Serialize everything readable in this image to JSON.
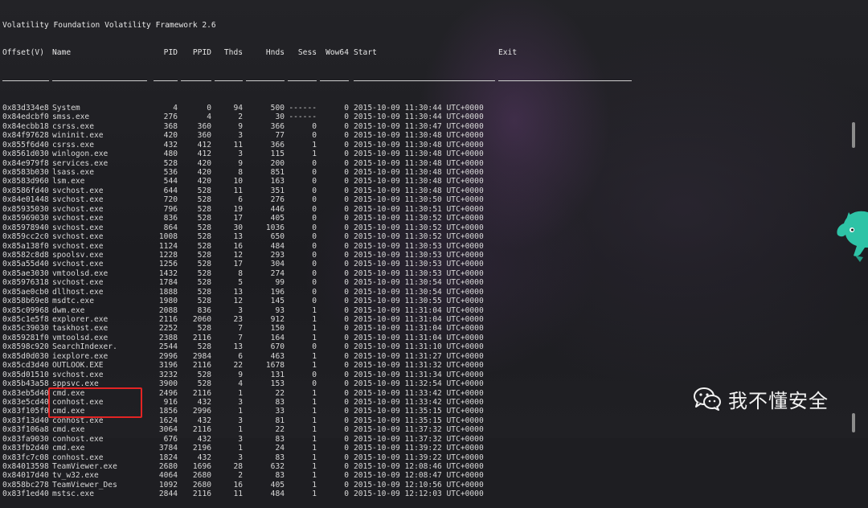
{
  "terminal": {
    "banner": "Volatility Foundation Volatility Framework 2.6",
    "columns": {
      "offset": "Offset(V)",
      "name": "Name",
      "pid": "PID",
      "ppid": "PPID",
      "thds": "Thds",
      "hnds": "Hnds",
      "sess": "Sess",
      "wow64": "Wow64",
      "start": "Start",
      "exit": "Exit"
    },
    "rows": [
      {
        "offset": "0x83d334e8",
        "name": "System",
        "pid": "4",
        "ppid": "0",
        "thds": "94",
        "hnds": "500",
        "sess": "------",
        "wow64": "0",
        "start": "2015-10-09 11:30:44 UTC+0000"
      },
      {
        "offset": "0x84edcbf0",
        "name": "smss.exe",
        "pid": "276",
        "ppid": "4",
        "thds": "2",
        "hnds": "30",
        "sess": "------",
        "wow64": "0",
        "start": "2015-10-09 11:30:44 UTC+0000"
      },
      {
        "offset": "0x84ecbb18",
        "name": "csrss.exe",
        "pid": "368",
        "ppid": "360",
        "thds": "9",
        "hnds": "366",
        "sess": "0",
        "wow64": "0",
        "start": "2015-10-09 11:30:47 UTC+0000"
      },
      {
        "offset": "0x84f97628",
        "name": "wininit.exe",
        "pid": "420",
        "ppid": "360",
        "thds": "3",
        "hnds": "77",
        "sess": "0",
        "wow64": "0",
        "start": "2015-10-09 11:30:48 UTC+0000"
      },
      {
        "offset": "0x855f6d40",
        "name": "csrss.exe",
        "pid": "432",
        "ppid": "412",
        "thds": "11",
        "hnds": "366",
        "sess": "1",
        "wow64": "0",
        "start": "2015-10-09 11:30:48 UTC+0000"
      },
      {
        "offset": "0x8561d030",
        "name": "winlogon.exe",
        "pid": "480",
        "ppid": "412",
        "thds": "3",
        "hnds": "115",
        "sess": "1",
        "wow64": "0",
        "start": "2015-10-09 11:30:48 UTC+0000"
      },
      {
        "offset": "0x84e979f8",
        "name": "services.exe",
        "pid": "528",
        "ppid": "420",
        "thds": "9",
        "hnds": "200",
        "sess": "0",
        "wow64": "0",
        "start": "2015-10-09 11:30:48 UTC+0000"
      },
      {
        "offset": "0x8583b030",
        "name": "lsass.exe",
        "pid": "536",
        "ppid": "420",
        "thds": "8",
        "hnds": "851",
        "sess": "0",
        "wow64": "0",
        "start": "2015-10-09 11:30:48 UTC+0000"
      },
      {
        "offset": "0x8583d960",
        "name": "lsm.exe",
        "pid": "544",
        "ppid": "420",
        "thds": "10",
        "hnds": "163",
        "sess": "0",
        "wow64": "0",
        "start": "2015-10-09 11:30:48 UTC+0000"
      },
      {
        "offset": "0x8586fd40",
        "name": "svchost.exe",
        "pid": "644",
        "ppid": "528",
        "thds": "11",
        "hnds": "351",
        "sess": "0",
        "wow64": "0",
        "start": "2015-10-09 11:30:48 UTC+0000"
      },
      {
        "offset": "0x84e01448",
        "name": "svchost.exe",
        "pid": "720",
        "ppid": "528",
        "thds": "6",
        "hnds": "276",
        "sess": "0",
        "wow64": "0",
        "start": "2015-10-09 11:30:50 UTC+0000"
      },
      {
        "offset": "0x85935030",
        "name": "svchost.exe",
        "pid": "796",
        "ppid": "528",
        "thds": "19",
        "hnds": "446",
        "sess": "0",
        "wow64": "0",
        "start": "2015-10-09 11:30:51 UTC+0000"
      },
      {
        "offset": "0x85969030",
        "name": "svchost.exe",
        "pid": "836",
        "ppid": "528",
        "thds": "17",
        "hnds": "405",
        "sess": "0",
        "wow64": "0",
        "start": "2015-10-09 11:30:52 UTC+0000"
      },
      {
        "offset": "0x85978940",
        "name": "svchost.exe",
        "pid": "864",
        "ppid": "528",
        "thds": "30",
        "hnds": "1036",
        "sess": "0",
        "wow64": "0",
        "start": "2015-10-09 11:30:52 UTC+0000"
      },
      {
        "offset": "0x859cc2c0",
        "name": "svchost.exe",
        "pid": "1008",
        "ppid": "528",
        "thds": "13",
        "hnds": "650",
        "sess": "0",
        "wow64": "0",
        "start": "2015-10-09 11:30:52 UTC+0000"
      },
      {
        "offset": "0x85a138f0",
        "name": "svchost.exe",
        "pid": "1124",
        "ppid": "528",
        "thds": "16",
        "hnds": "484",
        "sess": "0",
        "wow64": "0",
        "start": "2015-10-09 11:30:53 UTC+0000"
      },
      {
        "offset": "0x8582c8d8",
        "name": "spoolsv.exe",
        "pid": "1228",
        "ppid": "528",
        "thds": "12",
        "hnds": "293",
        "sess": "0",
        "wow64": "0",
        "start": "2015-10-09 11:30:53 UTC+0000"
      },
      {
        "offset": "0x85a55d40",
        "name": "svchost.exe",
        "pid": "1256",
        "ppid": "528",
        "thds": "17",
        "hnds": "304",
        "sess": "0",
        "wow64": "0",
        "start": "2015-10-09 11:30:53 UTC+0000"
      },
      {
        "offset": "0x85ae3030",
        "name": "vmtoolsd.exe",
        "pid": "1432",
        "ppid": "528",
        "thds": "8",
        "hnds": "274",
        "sess": "0",
        "wow64": "0",
        "start": "2015-10-09 11:30:53 UTC+0000"
      },
      {
        "offset": "0x85976318",
        "name": "svchost.exe",
        "pid": "1784",
        "ppid": "528",
        "thds": "5",
        "hnds": "99",
        "sess": "0",
        "wow64": "0",
        "start": "2015-10-09 11:30:54 UTC+0000"
      },
      {
        "offset": "0x85ae0cb0",
        "name": "dllhost.exe",
        "pid": "1888",
        "ppid": "528",
        "thds": "13",
        "hnds": "196",
        "sess": "0",
        "wow64": "0",
        "start": "2015-10-09 11:30:54 UTC+0000"
      },
      {
        "offset": "0x858b69e8",
        "name": "msdtc.exe",
        "pid": "1980",
        "ppid": "528",
        "thds": "12",
        "hnds": "145",
        "sess": "0",
        "wow64": "0",
        "start": "2015-10-09 11:30:55 UTC+0000"
      },
      {
        "offset": "0x85c09968",
        "name": "dwm.exe",
        "pid": "2088",
        "ppid": "836",
        "thds": "3",
        "hnds": "93",
        "sess": "1",
        "wow64": "0",
        "start": "2015-10-09 11:31:04 UTC+0000"
      },
      {
        "offset": "0x85c1e5f8",
        "name": "explorer.exe",
        "pid": "2116",
        "ppid": "2060",
        "thds": "23",
        "hnds": "912",
        "sess": "1",
        "wow64": "0",
        "start": "2015-10-09 11:31:04 UTC+0000"
      },
      {
        "offset": "0x85c39030",
        "name": "taskhost.exe",
        "pid": "2252",
        "ppid": "528",
        "thds": "7",
        "hnds": "150",
        "sess": "1",
        "wow64": "0",
        "start": "2015-10-09 11:31:04 UTC+0000"
      },
      {
        "offset": "0x859281f0",
        "name": "vmtoolsd.exe",
        "pid": "2388",
        "ppid": "2116",
        "thds": "7",
        "hnds": "164",
        "sess": "1",
        "wow64": "0",
        "start": "2015-10-09 11:31:04 UTC+0000"
      },
      {
        "offset": "0x8598c920",
        "name": "SearchIndexer.",
        "pid": "2544",
        "ppid": "528",
        "thds": "13",
        "hnds": "670",
        "sess": "0",
        "wow64": "0",
        "start": "2015-10-09 11:31:10 UTC+0000"
      },
      {
        "offset": "0x85d0d030",
        "name": "iexplore.exe",
        "pid": "2996",
        "ppid": "2984",
        "thds": "6",
        "hnds": "463",
        "sess": "1",
        "wow64": "0",
        "start": "2015-10-09 11:31:27 UTC+0000"
      },
      {
        "offset": "0x85cd3d40",
        "name": "OUTLOOK.EXE",
        "pid": "3196",
        "ppid": "2116",
        "thds": "22",
        "hnds": "1678",
        "sess": "1",
        "wow64": "0",
        "start": "2015-10-09 11:31:32 UTC+0000"
      },
      {
        "offset": "0x85d01510",
        "name": "svchost.exe",
        "pid": "3232",
        "ppid": "528",
        "thds": "9",
        "hnds": "131",
        "sess": "0",
        "wow64": "0",
        "start": "2015-10-09 11:31:34 UTC+0000"
      },
      {
        "offset": "0x85b43a58",
        "name": "sppsvc.exe",
        "pid": "3900",
        "ppid": "528",
        "thds": "4",
        "hnds": "153",
        "sess": "0",
        "wow64": "0",
        "start": "2015-10-09 11:32:54 UTC+0000"
      },
      {
        "offset": "0x83eb5d40",
        "name": "cmd.exe",
        "pid": "2496",
        "ppid": "2116",
        "thds": "1",
        "hnds": "22",
        "sess": "1",
        "wow64": "0",
        "start": "2015-10-09 11:33:42 UTC+0000"
      },
      {
        "offset": "0x83e5cd40",
        "name": "conhost.exe",
        "pid": "916",
        "ppid": "432",
        "thds": "3",
        "hnds": "83",
        "sess": "1",
        "wow64": "0",
        "start": "2015-10-09 11:33:42 UTC+0000"
      },
      {
        "offset": "0x83f105f0",
        "name": "cmd.exe",
        "pid": "1856",
        "ppid": "2996",
        "thds": "1",
        "hnds": "33",
        "sess": "1",
        "wow64": "0",
        "start": "2015-10-09 11:35:15 UTC+0000"
      },
      {
        "offset": "0x83f13d40",
        "name": "conhost.exe",
        "pid": "1624",
        "ppid": "432",
        "thds": "3",
        "hnds": "81",
        "sess": "1",
        "wow64": "0",
        "start": "2015-10-09 11:35:15 UTC+0000"
      },
      {
        "offset": "0x83f106a8",
        "name": "cmd.exe",
        "pid": "3064",
        "ppid": "2116",
        "thds": "1",
        "hnds": "22",
        "sess": "1",
        "wow64": "0",
        "start": "2015-10-09 11:37:32 UTC+0000"
      },
      {
        "offset": "0x83fa9030",
        "name": "conhost.exe",
        "pid": "676",
        "ppid": "432",
        "thds": "3",
        "hnds": "83",
        "sess": "1",
        "wow64": "0",
        "start": "2015-10-09 11:37:32 UTC+0000"
      },
      {
        "offset": "0x83fb2d40",
        "name": "cmd.exe",
        "pid": "3784",
        "ppid": "2196",
        "thds": "1",
        "hnds": "24",
        "sess": "1",
        "wow64": "0",
        "start": "2015-10-09 11:39:22 UTC+0000"
      },
      {
        "offset": "0x83fc7c08",
        "name": "conhost.exe",
        "pid": "1824",
        "ppid": "432",
        "thds": "3",
        "hnds": "83",
        "sess": "1",
        "wow64": "0",
        "start": "2015-10-09 11:39:22 UTC+0000"
      },
      {
        "offset": "0x84013598",
        "name": "TeamViewer.exe",
        "pid": "2680",
        "ppid": "1696",
        "thds": "28",
        "hnds": "632",
        "sess": "1",
        "wow64": "0",
        "start": "2015-10-09 12:08:46 UTC+0000"
      },
      {
        "offset": "0x84017d40",
        "name": "tv_w32.exe",
        "pid": "4064",
        "ppid": "2680",
        "thds": "2",
        "hnds": "83",
        "sess": "1",
        "wow64": "0",
        "start": "2015-10-09 12:08:47 UTC+0000"
      },
      {
        "offset": "0x858bc278",
        "name": "TeamViewer_Des",
        "pid": "1092",
        "ppid": "2680",
        "thds": "16",
        "hnds": "405",
        "sess": "1",
        "wow64": "0",
        "start": "2015-10-09 12:10:56 UTC+0000"
      },
      {
        "offset": "0x83f1ed40",
        "name": "mstsc.exe",
        "pid": "2844",
        "ppid": "2116",
        "thds": "11",
        "hnds": "484",
        "sess": "1",
        "wow64": "0",
        "start": "2015-10-09 12:12:03 UTC+0000"
      }
    ]
  },
  "watermark": {
    "text": "我不懂安全",
    "icon": "wechat-icon"
  },
  "colors": {
    "terminal_text": "#d8d8d8",
    "background": "#1e1e22",
    "highlight_box": "#e32424",
    "mascot": "#2ec3a6"
  }
}
